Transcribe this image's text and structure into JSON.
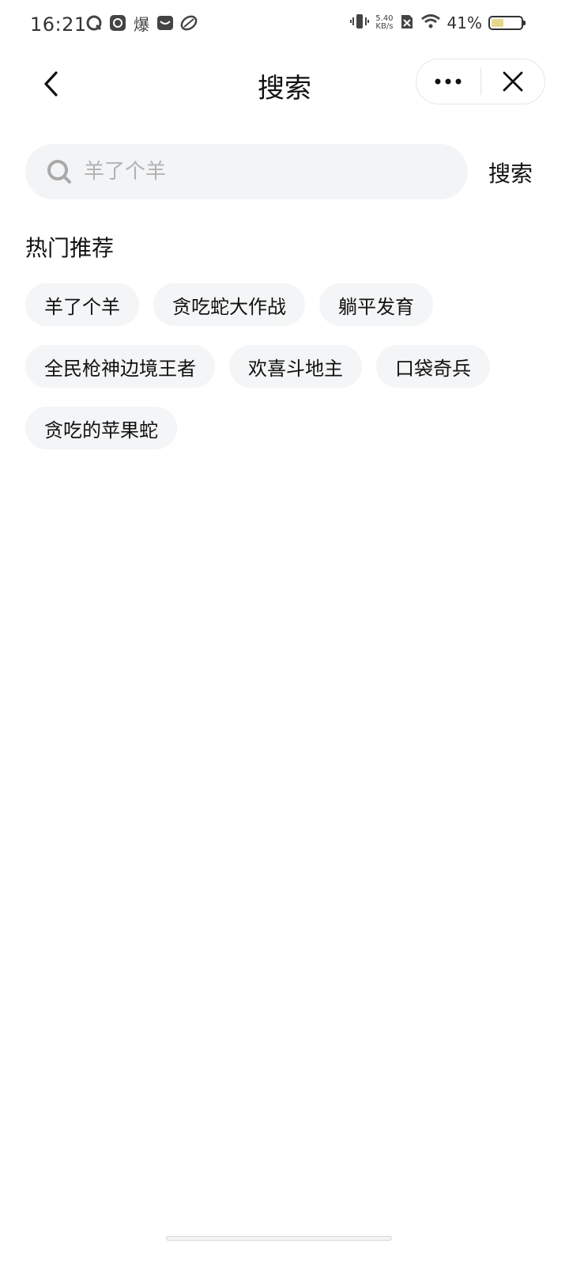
{
  "status_bar": {
    "time": "16:21",
    "app_icons": [
      "message-icon",
      "app-du-icon",
      "bao-icon",
      "mail-icon",
      "leaf-icon"
    ],
    "bao_text": "爆",
    "speed_value": "5.40",
    "speed_unit": "KB/s",
    "battery_percent": "41%",
    "battery_level": 0.41
  },
  "header": {
    "title": "搜索",
    "back_icon": "chevron-left-icon",
    "more_icon": "more-dots-icon",
    "close_icon": "close-icon"
  },
  "search": {
    "placeholder": "羊了个羊",
    "value": "",
    "submit_label": "搜索",
    "icon": "search-icon"
  },
  "hot": {
    "title": "热门推荐",
    "tags": [
      "羊了个羊",
      "贪吃蛇大作战",
      "躺平发育",
      "全民枪神边境王者",
      "欢喜斗地主",
      "口袋奇兵",
      "贪吃的苹果蛇"
    ]
  },
  "colors": {
    "background": "#ffffff",
    "search_bg": "#f3f4f6",
    "tag_bg": "#f4f5f6",
    "placeholder": "#b2b2b2",
    "text": "#111111"
  }
}
